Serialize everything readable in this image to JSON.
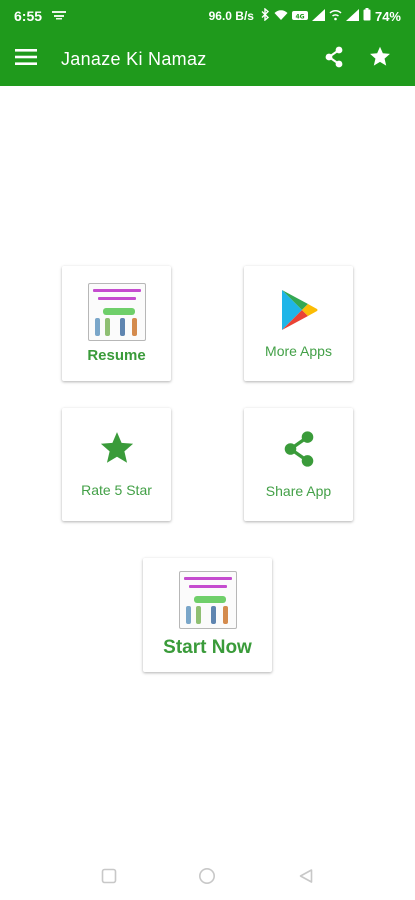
{
  "status_bar": {
    "time": "6:55",
    "network_speed": "96.0 B/s",
    "battery": "74%"
  },
  "app_bar": {
    "title": "Janaze Ki Namaz",
    "icons": [
      "menu-icon",
      "share-icon",
      "star-icon"
    ]
  },
  "cards": {
    "resume": {
      "label": "Resume",
      "icon": "app-thumbnail-icon"
    },
    "more_apps": {
      "label": "More Apps",
      "icon": "play-store-icon"
    },
    "rate": {
      "label": "Rate 5 Star",
      "icon": "star-icon"
    },
    "share": {
      "label": "Share App",
      "icon": "share-icon"
    },
    "start": {
      "label": "Start Now",
      "icon": "app-thumbnail-icon"
    }
  },
  "nav_bar": {
    "icons": [
      "recent-apps-icon",
      "home-icon",
      "back-icon"
    ]
  },
  "colors": {
    "primary": "#1f9a1c",
    "accent_text": "#43a047",
    "background": "#ffffff"
  }
}
